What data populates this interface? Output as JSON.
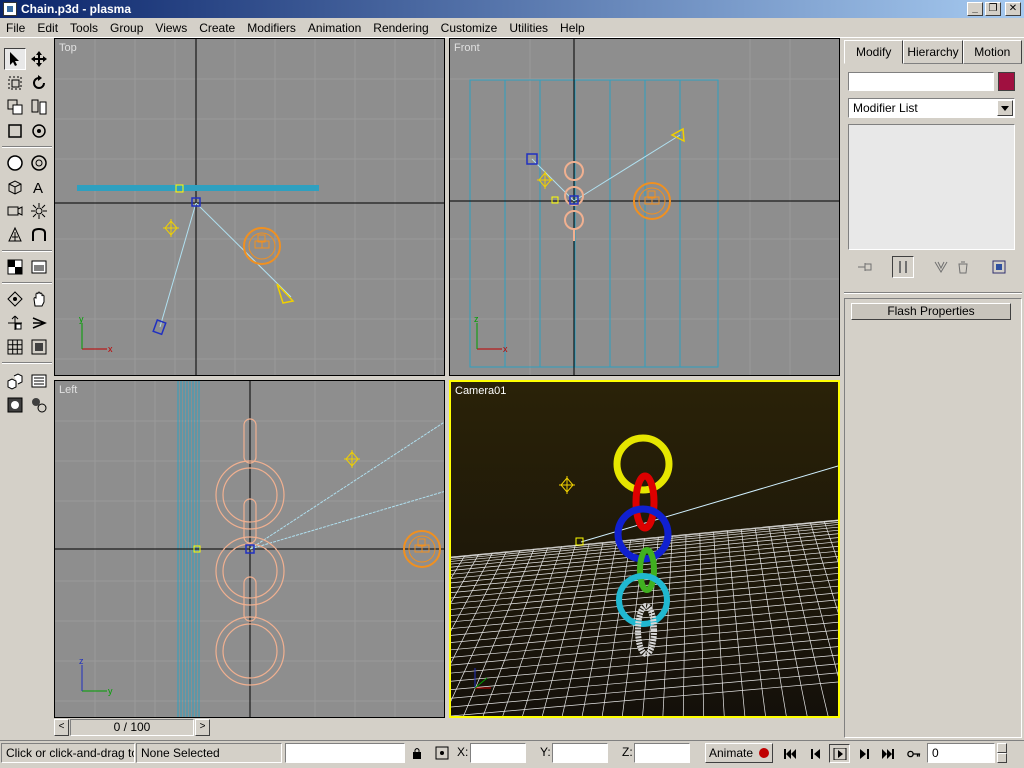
{
  "window": {
    "title": "Chain.p3d - plasma",
    "controls": [
      "_",
      "❐",
      "✕"
    ]
  },
  "menu": [
    "File",
    "Edit",
    "Tools",
    "Group",
    "Views",
    "Create",
    "Modifiers",
    "Animation",
    "Rendering",
    "Customize",
    "Utilities",
    "Help"
  ],
  "viewports": {
    "top": {
      "label": "Top"
    },
    "front": {
      "label": "Front"
    },
    "left": {
      "label": "Left"
    },
    "camera": {
      "label": "Camera01"
    }
  },
  "axis_labels": {
    "x": "x",
    "y": "y",
    "z": "z"
  },
  "command_panel": {
    "tabs": [
      "Modify",
      "Hierarchy",
      "Motion"
    ],
    "active_tab": "Modify",
    "object_name": "",
    "object_color": "#a01040",
    "modifier_list": "Modifier List",
    "rollout": "Flash Properties"
  },
  "time_slider": {
    "label": "0 / 100",
    "prev": "<",
    "next": ">"
  },
  "status_bar": {
    "prompt": "Click or click-and-drag to se",
    "selection": "None Selected",
    "x_label": "X:",
    "y_label": "Y:",
    "z_label": "Z:",
    "animate_label": "Animate",
    "frame_value": "0"
  },
  "colors": {
    "active_viewport_border": "#ffff00",
    "viewport_bg": "#8e8e8e",
    "camera_bg": "#201a08",
    "ring_colors": [
      "#e6e600",
      "#dd0000",
      "#1020d0",
      "#40b020",
      "#20b8d0",
      "#d8d8d8"
    ]
  }
}
